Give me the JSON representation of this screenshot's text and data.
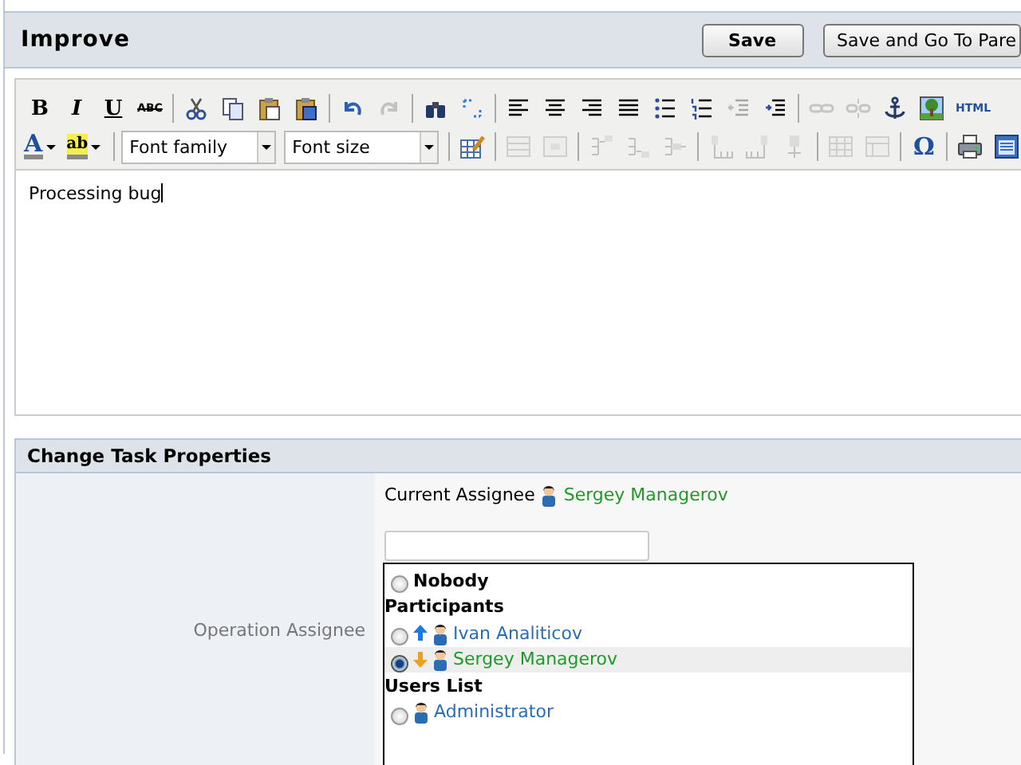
{
  "header": {
    "title": "Improve",
    "buttons": [
      {
        "label": "Save",
        "kind": "primary"
      },
      {
        "label": "Save and Go To Pare",
        "kind": "secondary"
      }
    ]
  },
  "toolbar": {
    "rows": [
      {
        "groups": [
          [
            {
              "kind": "glyph",
              "label": "B",
              "disabled": false
            },
            {
              "kind": "glyph",
              "label": "I",
              "disabled": false
            },
            {
              "kind": "glyph",
              "label": "U",
              "disabled": false
            },
            {
              "kind": "glyph",
              "label": "ABC",
              "disabled": false
            }
          ],
          [
            {
              "kind": "icon",
              "disabled": false
            },
            {
              "kind": "icon",
              "disabled": false
            },
            {
              "kind": "icon",
              "disabled": false
            },
            {
              "kind": "icon",
              "disabled": false
            }
          ],
          [
            {
              "kind": "icon",
              "disabled": false
            },
            {
              "kind": "icon",
              "disabled": true
            }
          ],
          [
            {
              "kind": "icon",
              "disabled": false
            },
            {
              "kind": "icon",
              "disabled": false
            }
          ],
          [
            {
              "kind": "icon",
              "disabled": false
            },
            {
              "kind": "icon",
              "disabled": false
            },
            {
              "kind": "icon",
              "disabled": false
            },
            {
              "kind": "icon",
              "disabled": false
            },
            {
              "kind": "icon",
              "disabled": false
            },
            {
              "kind": "icon",
              "disabled": false
            },
            {
              "kind": "icon",
              "disabled": true
            },
            {
              "kind": "icon",
              "disabled": false
            }
          ],
          [
            {
              "kind": "icon",
              "disabled": true
            },
            {
              "kind": "icon",
              "disabled": true
            },
            {
              "kind": "icon",
              "disabled": false
            },
            {
              "kind": "icon",
              "disabled": false
            },
            {
              "kind": "glyph",
              "label": "HTML",
              "disabled": false
            }
          ]
        ]
      },
      {
        "groups": [
          [
            {
              "kind": "color",
              "label": "A",
              "disabled": false
            },
            {
              "kind": "color",
              "label": "ab",
              "disabled": false
            }
          ],
          [
            {
              "kind": "select",
              "value": "Font family",
              "disabled": false
            },
            {
              "kind": "select",
              "value": "Font size",
              "disabled": false
            }
          ],
          [
            {
              "kind": "icon",
              "disabled": false
            }
          ],
          [
            {
              "kind": "icon",
              "disabled": true
            },
            {
              "kind": "icon",
              "disabled": true
            }
          ],
          [
            {
              "kind": "icon",
              "disabled": true
            },
            {
              "kind": "icon",
              "disabled": true
            },
            {
              "kind": "icon",
              "disabled": true
            }
          ],
          [
            {
              "kind": "icon",
              "disabled": true
            },
            {
              "kind": "icon",
              "disabled": true
            },
            {
              "kind": "icon",
              "disabled": true
            }
          ],
          [
            {
              "kind": "icon",
              "disabled": true
            },
            {
              "kind": "icon",
              "disabled": true
            }
          ],
          [
            {
              "kind": "glyph",
              "label": "Ω",
              "disabled": false
            }
          ],
          [
            {
              "kind": "icon",
              "disabled": false
            },
            {
              "kind": "icon",
              "disabled": false
            }
          ]
        ]
      }
    ]
  },
  "editor": {
    "content": "Processing bug"
  },
  "properties": {
    "title": "Change Task Properties",
    "current_assignee": {
      "label": "Current Assignee",
      "name": "Sergey Managerov",
      "color": "#1f9a2a"
    },
    "operation_assignee": {
      "label": "Operation Assignee",
      "options": [
        {
          "kind": "none",
          "label": "Nobody",
          "selected": false
        },
        {
          "kind": "group",
          "label": "Participants"
        },
        {
          "kind": "user_up",
          "label": "Ivan Analiticov",
          "color": "#2a6db5",
          "selected": false
        },
        {
          "kind": "user_down",
          "label": "Sergey Managerov",
          "color": "#1f9a2a",
          "selected": true
        },
        {
          "kind": "group",
          "label": "Users List"
        },
        {
          "kind": "user",
          "label": "Administrator",
          "color": "#2a6db5",
          "selected": false
        }
      ]
    }
  }
}
